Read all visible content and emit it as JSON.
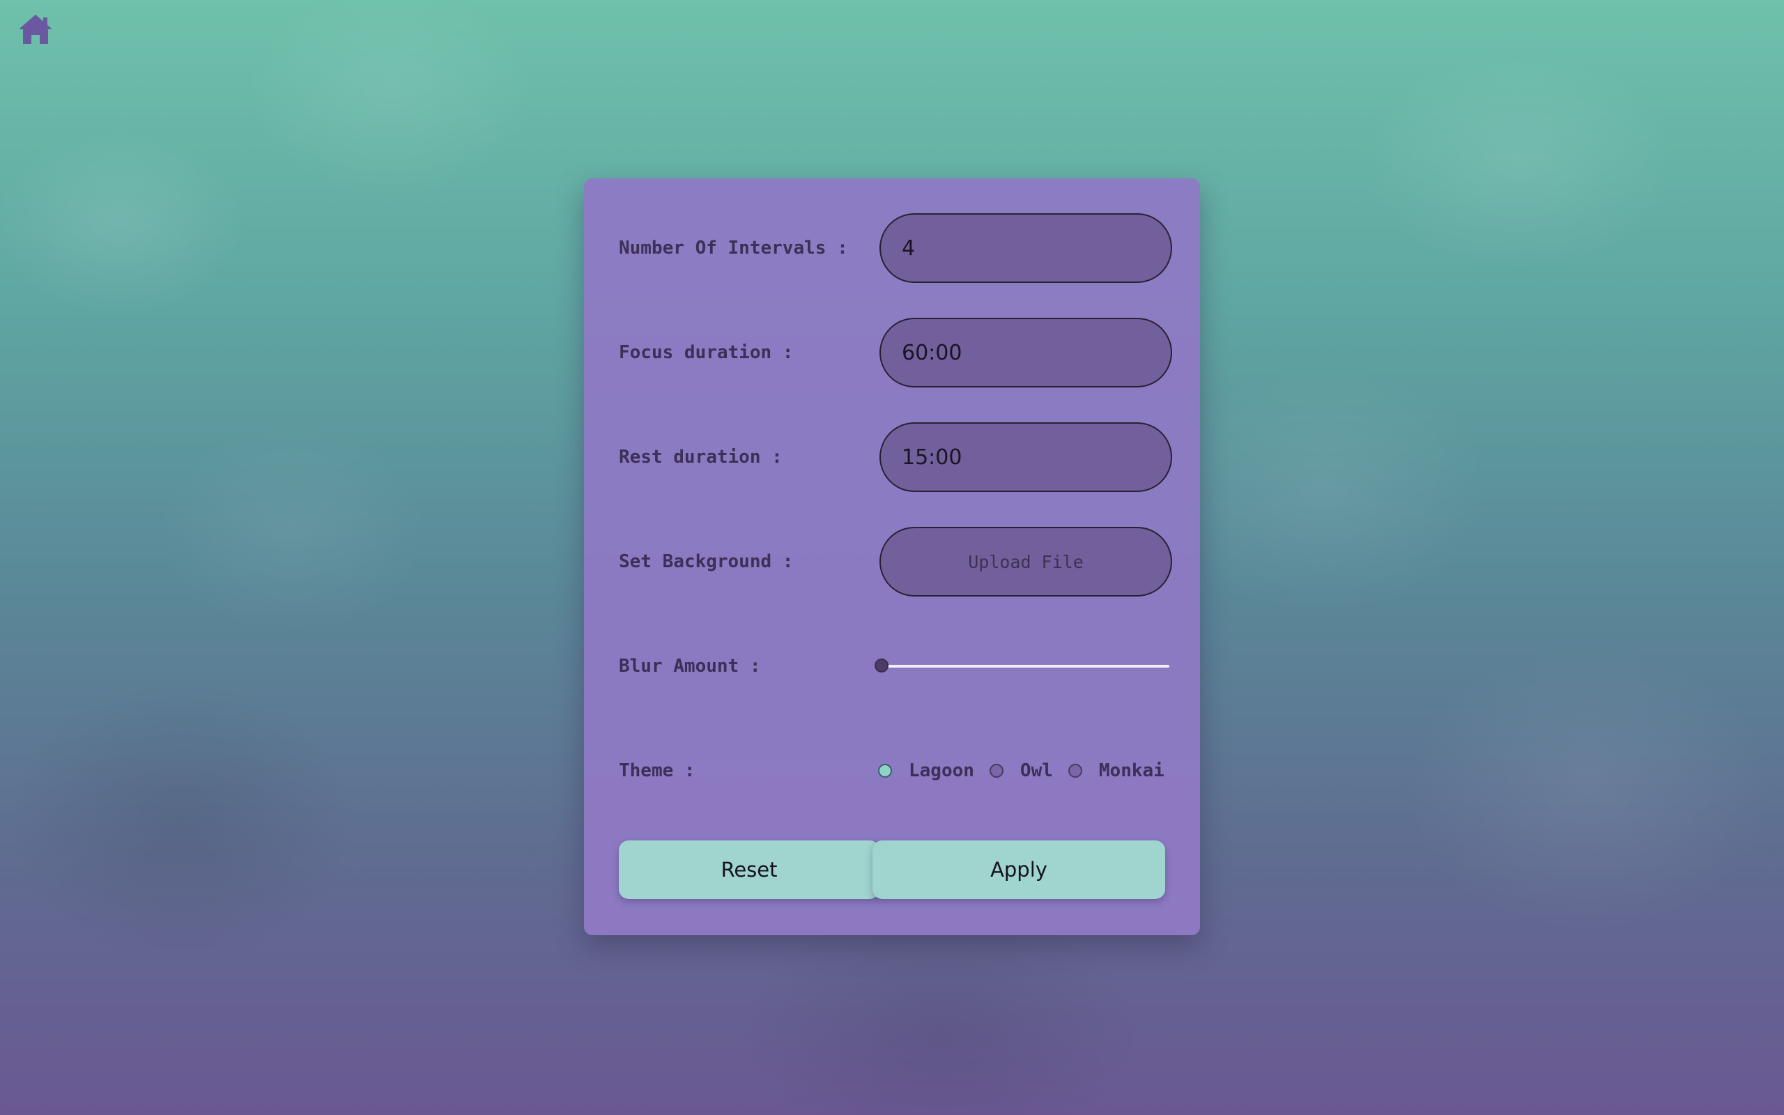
{
  "icons": {
    "home": "home-icon"
  },
  "colors": {
    "panel": "#8e7ac4",
    "field": "#72609c",
    "button": "#9fd4cf",
    "label": "#3d2f57",
    "theme_selected": "#8fd3c6"
  },
  "settings": {
    "intervals": {
      "label": "Number Of Intervals :",
      "value": "4"
    },
    "focus": {
      "label": "Focus duration :",
      "value": "60:00"
    },
    "rest": {
      "label": "Rest duration :",
      "value": "15:00"
    },
    "background": {
      "label": "Set Background :",
      "button_label": "Upload File"
    },
    "blur": {
      "label": "Blur Amount :",
      "value": 0
    },
    "theme": {
      "label": "Theme :",
      "options": [
        "Lagoon",
        "Owl",
        "Monkai"
      ],
      "selected": "Lagoon"
    }
  },
  "actions": {
    "reset_label": "Reset",
    "apply_label": "Apply"
  }
}
